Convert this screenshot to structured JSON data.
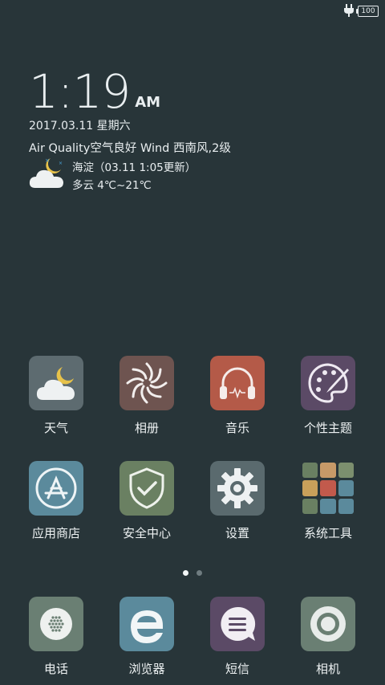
{
  "status_bar": {
    "battery": "100",
    "colors": {
      "fg": "#e9eef0"
    }
  },
  "clock": {
    "time": "1:19",
    "ampm": "AM"
  },
  "date_line": "2017.03.11 星期六",
  "air_line": "Air Quality空气良好 Wind 西南风,2级",
  "weather": {
    "location_line": "海淀（03.11 1:05更新）",
    "condition_line": "多云 4℃~21℃",
    "icon": "cloud-moon-icon"
  },
  "apps_row1": [
    {
      "label": "天气",
      "icon": "weather-cloud-moon-icon",
      "color": "#5d6b70"
    },
    {
      "label": "相册",
      "icon": "gallery-aperture-icon",
      "color": "#6e5450"
    },
    {
      "label": "音乐",
      "icon": "music-headphones-icon",
      "color": "#b45a48"
    },
    {
      "label": "个性主题",
      "icon": "theme-palette-icon",
      "color": "#5b4a66"
    }
  ],
  "apps_row2": [
    {
      "label": "应用商店",
      "icon": "app-store-icon",
      "color": "#5b8a9c"
    },
    {
      "label": "安全中心",
      "icon": "security-shield-icon",
      "color": "#6a8062"
    },
    {
      "label": "设置",
      "icon": "settings-gear-icon",
      "color": "#5a6a6e"
    },
    {
      "label": "系统工具",
      "icon": "system-tools-folder-icon",
      "color": "#283539"
    }
  ],
  "page_indicator": {
    "pages": 2,
    "active": 1
  },
  "dock": [
    {
      "label": "电话",
      "icon": "phone-icon",
      "color": "#6a7f73"
    },
    {
      "label": "浏览器",
      "icon": "browser-e-icon",
      "color": "#5b8a9c"
    },
    {
      "label": "短信",
      "icon": "messages-icon",
      "color": "#5b4a66"
    },
    {
      "label": "相机",
      "icon": "camera-lens-icon",
      "color": "#6a7f73"
    }
  ]
}
